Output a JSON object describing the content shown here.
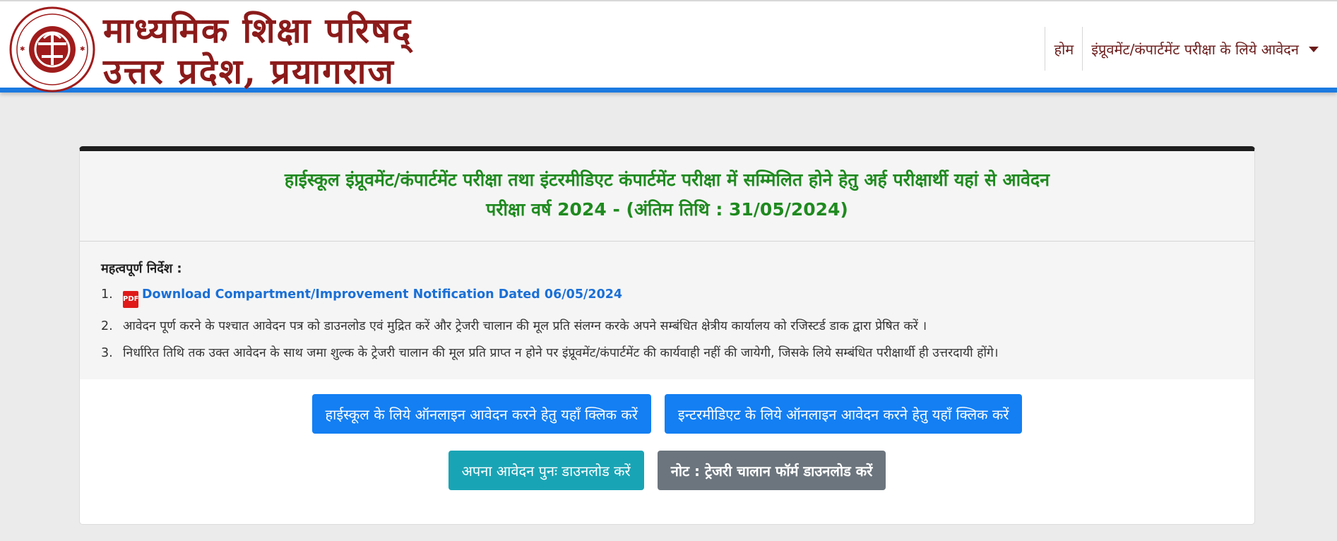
{
  "header": {
    "brand_line1": "माध्यमिक शिक्षा परिषद्",
    "brand_line2": "उत्तर प्रदेश, प्रयागराज",
    "logo_top_text": "माध्यमिक शिक्षा परिषद",
    "logo_bottom_text": "उत्तर प्रदेश",
    "nav": {
      "home": "होम",
      "apply_menu": "इंप्रूवमेंट/कंपार्टमेंट परीक्षा के लिये आवेदन"
    }
  },
  "card": {
    "title_line1": "हाईस्कूल इंप्रूवमेंट/कंपार्टमेंट परीक्षा तथा इंटरमीडिएट कंपार्टमेंट परीक्षा में सम्मिलित होने हेतु अर्ह परीक्षार्थी यहां से आवेदन",
    "title_line2": "परीक्षा वर्ष 2024 - (अंतिम तिथि : 31/05/2024)",
    "instructions_heading": "महत्वपूर्ण निर्देश :",
    "instructions": [
      {
        "num": "1.",
        "text": "Download Compartment/Improvement Notification Dated 06/05/2024"
      },
      {
        "num": "2.",
        "text": "आवेदन पूर्ण करने के पश्चात आवेदन पत्र को डाउनलोड एवं मुद्रित करें और ट्रेजरी चालान की मूल प्रति संलग्न करके अपने सम्बंधित क्षेत्रीय कार्यालय को रजिस्टर्ड डाक द्वारा प्रेषित करें ।"
      },
      {
        "num": "3.",
        "text": "निर्धारित तिथि तक उक्त आवेदन के साथ जमा शुल्क के ट्रेजरी चालान की मूल प्रति प्राप्त न होने पर इंप्रूवमेंट/कंपार्टमेंट की कार्यवाही नहीं की जायेगी, जिसके लिये सम्बंधित परीक्षार्थी ही उत्तरदायी होंगे।"
      }
    ],
    "buttons": {
      "highschool_apply": "हाईस्कूल के लिये ऑनलाइन आवेदन करने हेतु यहाँ क्लिक करें",
      "intermediate_apply": "इन्टरमीडिएट के लिये ऑनलाइन आवेदन करने हेतु यहाँ क्लिक करें",
      "redownload": "अपना आवेदन पुनः डाउनलोड करें",
      "treasury_note": "नोट : ट्रेजरी चालान फॉर्म डाउनलोड करें"
    }
  },
  "colors": {
    "brand": "#8b1a1a",
    "accent_bar": "#1c7ae0",
    "title_green": "#1f8a1f",
    "btn_blue": "#137ff3",
    "btn_teal": "#19a4b5",
    "btn_gray": "#6c757d"
  }
}
